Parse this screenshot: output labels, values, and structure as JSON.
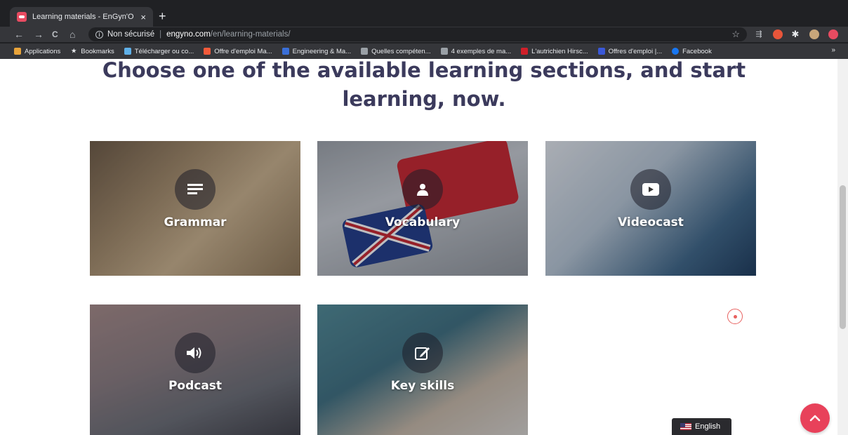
{
  "browser": {
    "tab_title": "Learning materials - EnGyn'O",
    "tab_close": "×",
    "new_tab": "+",
    "nav": {
      "back": "←",
      "forward": "→",
      "reload": "C",
      "home": "⌂"
    },
    "url_security": "Non sécurisé",
    "url_host": "engyno.com",
    "url_path": "/en/learning-materials/",
    "bookmarks": [
      {
        "label": "Applications",
        "icon_color": "#e8a33a"
      },
      {
        "label": "Bookmarks",
        "icon_color": "#e8eaed"
      },
      {
        "label": "Télécharger ou co...",
        "icon_color": "#5fb0e8"
      },
      {
        "label": "Offre d'emploi Ma...",
        "icon_color": "#f25a3a"
      },
      {
        "label": "Engineering & Ma...",
        "icon_color": "#3a6fd8"
      },
      {
        "label": "Quelles compéten...",
        "icon_color": "#9aa0a6"
      },
      {
        "label": "4 exemples de ma...",
        "icon_color": "#9aa0a6"
      },
      {
        "label": "L'autrichien Hirsc...",
        "icon_color": "#d0202a"
      },
      {
        "label": "Offres d'emploi |...",
        "icon_color": "#3a58d8"
      },
      {
        "label": "Facebook",
        "icon_color": "#1877f2"
      }
    ],
    "bookmarks_more": "»"
  },
  "page": {
    "headline_line1": "Choose one of the available learning sections, and start",
    "headline_line2": "learning, now.",
    "sections": [
      {
        "label": "Grammar",
        "icon": "list-icon"
      },
      {
        "label": "Vocabulary",
        "icon": "student-icon"
      },
      {
        "label": "Videocast",
        "icon": "play-icon"
      },
      {
        "label": "Podcast",
        "icon": "speaker-icon"
      },
      {
        "label": "Key skills",
        "icon": "edit-icon"
      }
    ],
    "language_label": "English"
  },
  "colors": {
    "headline": "#3b3a5c",
    "accent": "#e8415a"
  }
}
